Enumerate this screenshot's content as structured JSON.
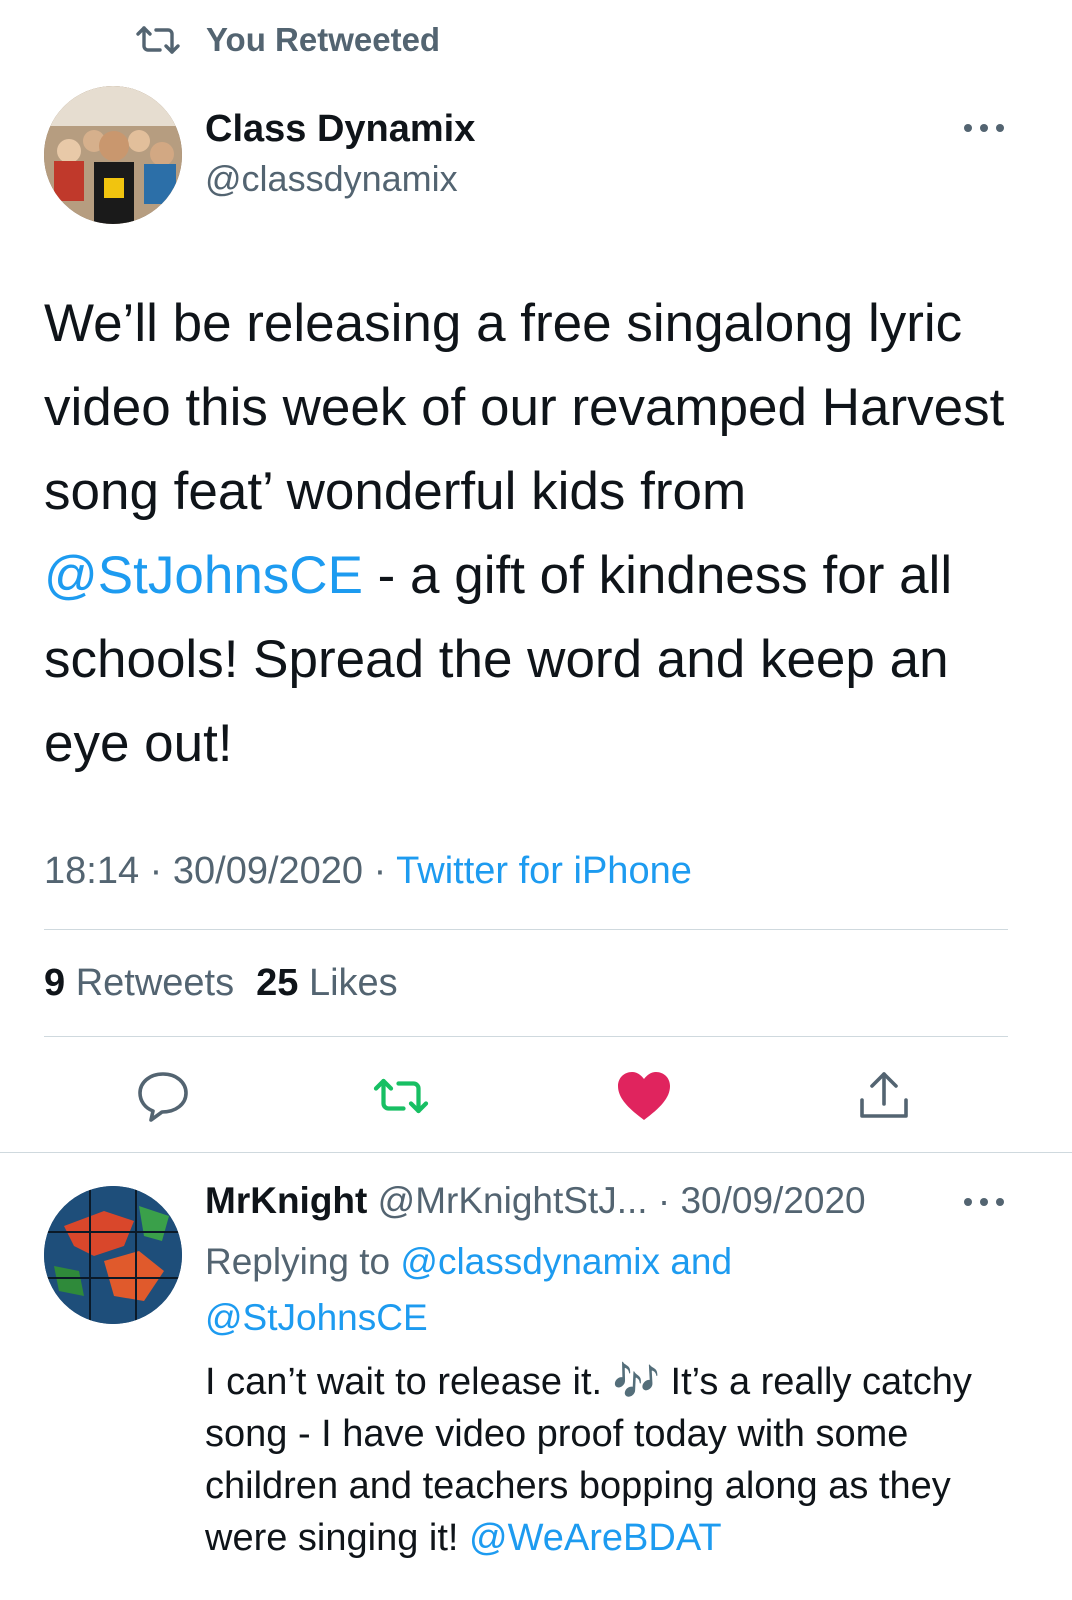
{
  "retweet_header": {
    "label": "You Retweeted"
  },
  "tweet": {
    "author_name": "Class Dynamix",
    "author_handle": "@classdynamix",
    "text_before": "We’ll be releasing a free singalong lyric video this week of our revamped Harvest song feat’ wonderful kids from ",
    "text_mention": "@StJohnsCE",
    "text_after": " - a gift of kindness for all schools! Spread the word and keep an eye out!",
    "time": "18:14",
    "date": "30/09/2020",
    "separator": "·",
    "source": "Twitter for iPhone",
    "retweets_count": "9",
    "retweets_label": "Retweets",
    "likes_count": "25",
    "likes_label": "Likes"
  },
  "actions": {
    "reply_icon": "speech-bubble-icon",
    "retweet_icon": "retweet-icon",
    "retweet_color": "#17bf63",
    "like_icon": "heart-icon",
    "like_color": "#e0245e",
    "share_icon": "share-icon"
  },
  "reply": {
    "author_name": "MrKnight",
    "author_handle": "@MrKnightStJ...",
    "separator": "·",
    "date": "30/09/2020",
    "replying_prefix": "Replying to",
    "replying_mention_1": "@classdynamix",
    "replying_and": "and",
    "replying_mention_2": "@StJohnsCE",
    "text_part1": "I can’t wait to release it. ",
    "emoji": "🎶",
    "text_part2": " It’s a really catchy song - I have video proof today with some children and teachers bopping along as they were singing it! ",
    "text_mention": "@WeAreBDAT"
  },
  "colors": {
    "link": "#1d9bf0",
    "secondary_text": "#536471",
    "primary_text": "#0f1419",
    "divider": "#cfd9de"
  }
}
